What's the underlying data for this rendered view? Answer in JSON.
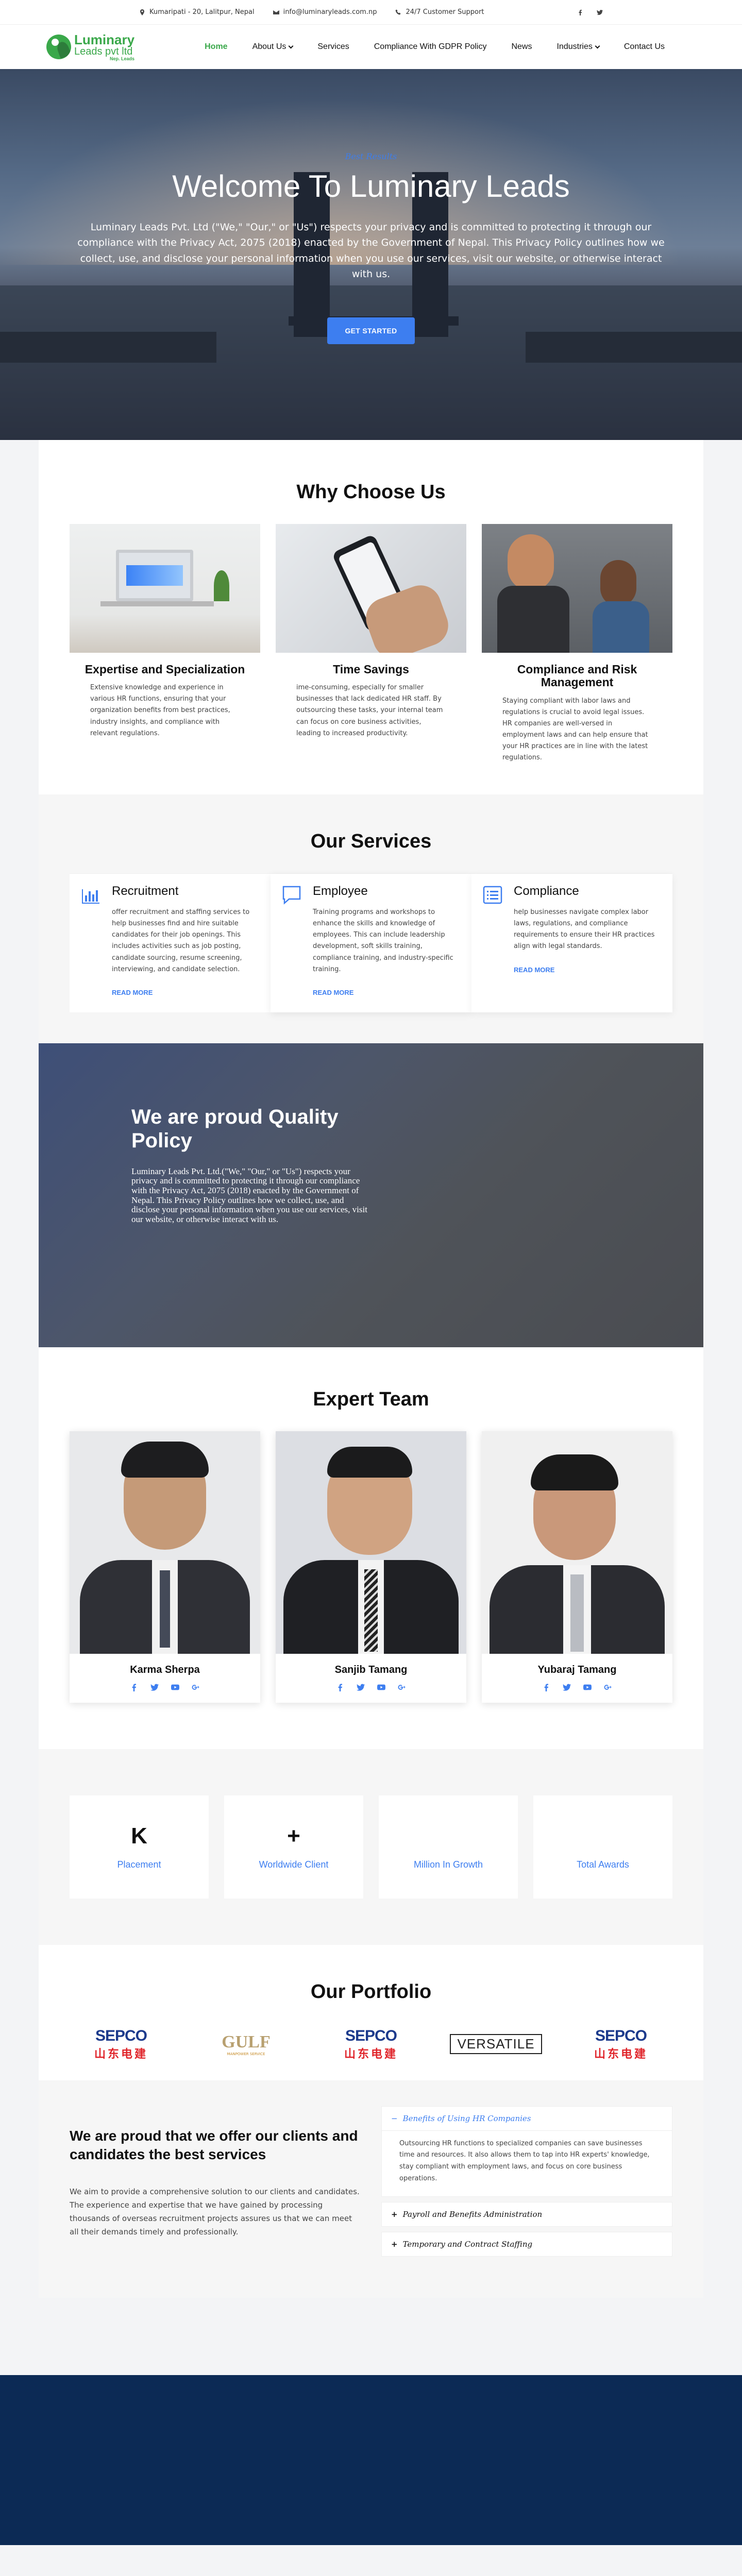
{
  "topbar": {
    "address": "Kumaripati - 20, Lalitpur, Nepal",
    "email": "info@luminaryleads.com.np",
    "support": "24/7 Customer Support"
  },
  "logo": {
    "line1": "Luminary",
    "line2": "Leads pvt ltd",
    "line3": "Nep. Leads"
  },
  "nav": {
    "home": "Home",
    "about": "About Us",
    "services": "Services",
    "compliance": "Compliance With GDPR Policy",
    "news": "News",
    "industries": "Industries",
    "contact": "Contact Us"
  },
  "hero": {
    "subtitle": "Best Results",
    "title": "Welcome To Luminary Leads",
    "text": "Luminary Leads Pvt. Ltd (\"We,\" \"Our,\" or \"Us\") respects your privacy and is committed to protecting it through our compliance with the Privacy Act, 2075 (2018) enacted by the Government of Nepal. This Privacy Policy outlines how we collect, use, and disclose your personal information when you use our services, visit our website, or otherwise interact with us.",
    "button": "GET STARTED"
  },
  "why": {
    "title": "Why Choose Us",
    "cards": [
      {
        "title": "Expertise and Specialization",
        "text": "Extensive knowledge and experience in various HR functions, ensuring that your organization benefits from best practices, industry insights, and compliance with relevant regulations."
      },
      {
        "title": "Time Savings",
        "text": "ime-consuming, especially for smaller businesses that lack dedicated HR staff. By outsourcing these tasks, your internal team can focus on core business activities, leading to increased productivity."
      },
      {
        "title": "Compliance and Risk Management",
        "text": "Staying compliant with labor laws and regulations is crucial to avoid legal issues. HR companies are well-versed in employment laws and can help ensure that your HR practices are in line with the latest regulations."
      }
    ]
  },
  "services": {
    "title": "Our Services",
    "items": [
      {
        "title": "Recruitment",
        "text": "offer recruitment and staffing services to help businesses find and hire suitable candidates for their job openings. This includes activities such as job posting, candidate sourcing, resume screening, interviewing, and candidate selection.",
        "link": "READ MORE"
      },
      {
        "title": "Employee",
        "text": "Training programs and workshops to enhance the skills and knowledge of employees. This can include leadership development, soft skills training, compliance training, and industry-specific training.",
        "link": "READ MORE"
      },
      {
        "title": "Compliance",
        "text": "help businesses navigate complex labor laws, regulations, and compliance requirements to ensure their HR practices align with legal standards.",
        "link": "READ MORE"
      }
    ]
  },
  "quality": {
    "title": "We are proud Quality Policy",
    "text": "Luminary Leads Pvt. Ltd.(\"We,\" \"Our,\" or \"Us\") respects your privacy and is committed to protecting it through our compliance with the Privacy Act, 2075 (2018) enacted by the Government of Nepal. This Privacy Policy outlines how we collect, use, and disclose your personal information when you use our services, visit our website, or otherwise interact with us."
  },
  "team": {
    "title": "Expert Team",
    "members": [
      {
        "name": "Karma Sherpa"
      },
      {
        "name": "Sanjib Tamang"
      },
      {
        "name": "Yubaraj Tamang"
      }
    ]
  },
  "stats": [
    {
      "number": "K",
      "label": "Placement"
    },
    {
      "number": "+",
      "label": "Worldwide Client"
    },
    {
      "number": "",
      "label": "Million In Growth"
    },
    {
      "number": "",
      "label": "Total Awards"
    }
  ],
  "portfolio": {
    "title": "Our Portfolio",
    "logos": [
      {
        "name": "SEPCO",
        "sub": "山东电建"
      },
      {
        "name": "GULF",
        "sub": "MANPOWER SERVICE"
      },
      {
        "name": "SEPCO",
        "sub": "山东电建"
      },
      {
        "name": "VERSATILE",
        "sub": ""
      },
      {
        "name": "SEPCO",
        "sub": "山东电建"
      }
    ]
  },
  "proud": {
    "title": "We are proud that we offer our clients and candidates the best services",
    "text": "We aim to provide a comprehensive solution to our clients and candidates. The experience and expertise that we have gained by processing thousands of overseas recruitment projects assures us that we can meet all their demands timely and professionally.",
    "accordion": [
      {
        "title": "Benefits of Using HR Companies",
        "open": true,
        "text": "Outsourcing HR functions to specialized companies can save businesses time and resources. It also allows them to tap into HR experts' knowledge, stay compliant with employment laws, and focus on core business operations."
      },
      {
        "title": "Payroll and Benefits Administration",
        "open": false,
        "text": ""
      },
      {
        "title": "Temporary and Contract Staffing",
        "open": false,
        "text": ""
      }
    ]
  },
  "colors": {
    "brand_green": "#3aa84a",
    "accent_blue": "#3d7ef0",
    "footer_navy": "#0c2a55"
  }
}
